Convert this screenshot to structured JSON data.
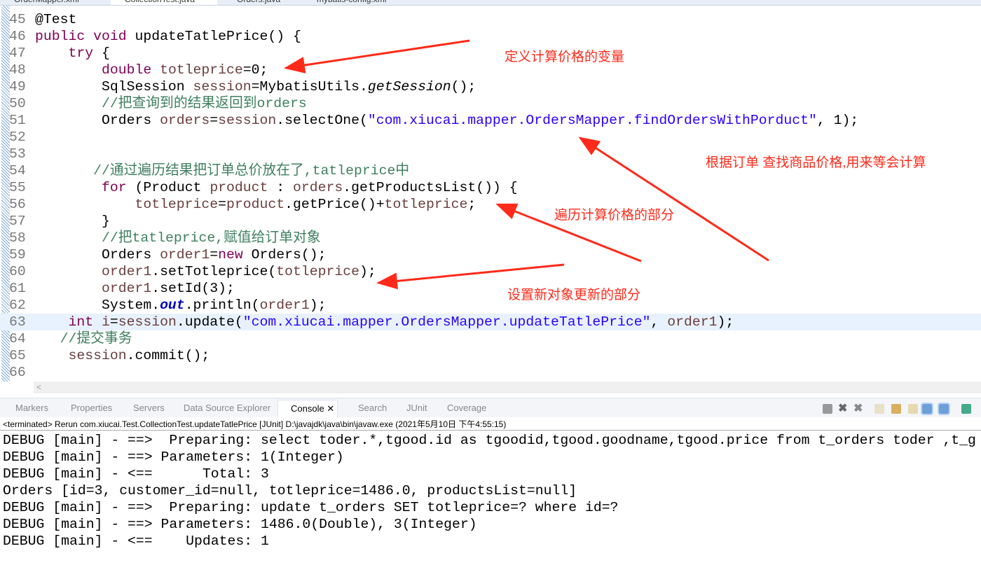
{
  "editor_tabs": [
    "OrderMapper.xml",
    "CollectionTest.java",
    "Orders.java",
    "mybatis-config.xml"
  ],
  "active_tab": 1,
  "code_lines": [
    {
      "n": "45",
      "t": [
        [
          "p",
          "@Test"
        ]
      ]
    },
    {
      "n": "46",
      "t": [
        [
          "k",
          "public void "
        ],
        [
          "p",
          "updateTatlePrice() {"
        ]
      ]
    },
    {
      "n": "47",
      "t": [
        [
          "p",
          "    "
        ],
        [
          "k",
          "try"
        ],
        [
          "p",
          " {"
        ]
      ]
    },
    {
      "n": "48",
      "t": [
        [
          "p",
          "        "
        ],
        [
          "k",
          "double "
        ],
        [
          "v",
          "totleprice"
        ],
        [
          "p",
          "=0;"
        ]
      ]
    },
    {
      "n": "49",
      "t": [
        [
          "p",
          "        SqlSession "
        ],
        [
          "v",
          "session"
        ],
        [
          "p",
          "=MybatisUtils."
        ],
        [
          "m",
          "getSession"
        ],
        [
          "p",
          "();"
        ]
      ]
    },
    {
      "n": "50",
      "t": [
        [
          "p",
          "        "
        ],
        [
          "c",
          "//把查询到的结果返回到orders"
        ]
      ]
    },
    {
      "n": "51",
      "t": [
        [
          "p",
          "        Orders "
        ],
        [
          "v",
          "orders"
        ],
        [
          "p",
          "="
        ],
        [
          "v",
          "session"
        ],
        [
          "p",
          ".selectOne("
        ],
        [
          "s",
          "\"com.xiucai.mapper.OrdersMapper.findOrdersWithPorduct\""
        ],
        [
          "p",
          ", 1);"
        ]
      ]
    },
    {
      "n": "52",
      "t": []
    },
    {
      "n": "53",
      "t": []
    },
    {
      "n": "54",
      "t": [
        [
          "p",
          "       "
        ],
        [
          "c",
          "//通过遍历结果把订单总价放在了,tatleprice中"
        ]
      ]
    },
    {
      "n": "55",
      "t": [
        [
          "p",
          "        "
        ],
        [
          "k",
          "for"
        ],
        [
          "p",
          " (Product "
        ],
        [
          "v",
          "product"
        ],
        [
          "p",
          " : "
        ],
        [
          "v",
          "orders"
        ],
        [
          "p",
          ".getProductsList()) {"
        ]
      ]
    },
    {
      "n": "56",
      "t": [
        [
          "p",
          "            "
        ],
        [
          "v",
          "totleprice"
        ],
        [
          "p",
          "="
        ],
        [
          "v",
          "product"
        ],
        [
          "p",
          ".getPrice()+"
        ],
        [
          "v",
          "totleprice"
        ],
        [
          "p",
          ";"
        ]
      ]
    },
    {
      "n": "57",
      "t": [
        [
          "p",
          "        }"
        ]
      ]
    },
    {
      "n": "58",
      "t": [
        [
          "p",
          "        "
        ],
        [
          "c",
          "//把tatleprice,赋值给订单对象"
        ]
      ]
    },
    {
      "n": "59",
      "t": [
        [
          "p",
          "        Orders "
        ],
        [
          "v",
          "order1"
        ],
        [
          "p",
          "="
        ],
        [
          "k",
          "new"
        ],
        [
          "p",
          " Orders();"
        ]
      ]
    },
    {
      "n": "60",
      "t": [
        [
          "p",
          "        "
        ],
        [
          "v",
          "order1"
        ],
        [
          "p",
          ".setTotleprice("
        ],
        [
          "v",
          "totleprice"
        ],
        [
          "p",
          ");"
        ]
      ]
    },
    {
      "n": "61",
      "t": [
        [
          "p",
          "        "
        ],
        [
          "v",
          "order1"
        ],
        [
          "p",
          ".setId(3);"
        ]
      ]
    },
    {
      "n": "62",
      "t": [
        [
          "p",
          "        System."
        ],
        [
          "f",
          "out"
        ],
        [
          "p",
          ".println("
        ],
        [
          "v",
          "order1"
        ],
        [
          "p",
          ");"
        ]
      ]
    },
    {
      "n": "63",
      "hl": true,
      "t": [
        [
          "p",
          "    "
        ],
        [
          "k",
          "int "
        ],
        [
          "v",
          "i"
        ],
        [
          "p",
          "="
        ],
        [
          "v",
          "session"
        ],
        [
          "p",
          ".update("
        ],
        [
          "s",
          "\"com.xiucai.mapper.OrdersMapper.updateTatlePrice\""
        ],
        [
          "p",
          ", "
        ],
        [
          "v",
          "order1"
        ],
        [
          "p",
          ");"
        ]
      ]
    },
    {
      "n": "64",
      "t": [
        [
          "p",
          "   "
        ],
        [
          "c",
          "//提交事务"
        ]
      ]
    },
    {
      "n": "65",
      "t": [
        [
          "p",
          "    "
        ],
        [
          "v",
          "session"
        ],
        [
          "p",
          ".commit();"
        ]
      ]
    },
    {
      "n": "66",
      "t": []
    }
  ],
  "view_tabs": [
    "Markers",
    "Properties",
    "Servers",
    "Data Source Explorer",
    "Console",
    "Search",
    "JUnit",
    "Coverage"
  ],
  "active_view": 4,
  "console_status": "<terminated> Rerun com.xiucai.Test.CollectionTest.updateTatlePrice [JUnit] D:\\javajdk\\java\\bin\\javaw.exe (2021年5月10日 下午4:55:15)",
  "console_lines": [
    "DEBUG [main] - ==>  Preparing: select toder.*,tgood.id as tgoodid,tgood.goodname,tgood.price from t_orders toder ,t_g",
    "DEBUG [main] - ==> Parameters: 1(Integer)",
    "DEBUG [main] - <==      Total: 3",
    "Orders [id=3, customer_id=null, totleprice=1486.0, productsList=null]",
    "DEBUG [main] - ==>  Preparing: update t_orders SET totleprice=? where id=?",
    "DEBUG [main] - ==> Parameters: 1486.0(Double), 3(Integer)",
    "DEBUG [main] - <==    Updates: 1"
  ],
  "annotations": {
    "a1": "定义计算价格的变量",
    "a2": "根据订单 查找商品价格,用来等会计算",
    "a3": "遍历计算价格的部分",
    "a4": "设置新对象更新的部分"
  },
  "colors": {
    "annotation": "#ff2a1a",
    "keyword": "#7f0055",
    "string": "#2a00ff",
    "comment": "#3f7f5f",
    "variable": "#6a3e3e"
  }
}
